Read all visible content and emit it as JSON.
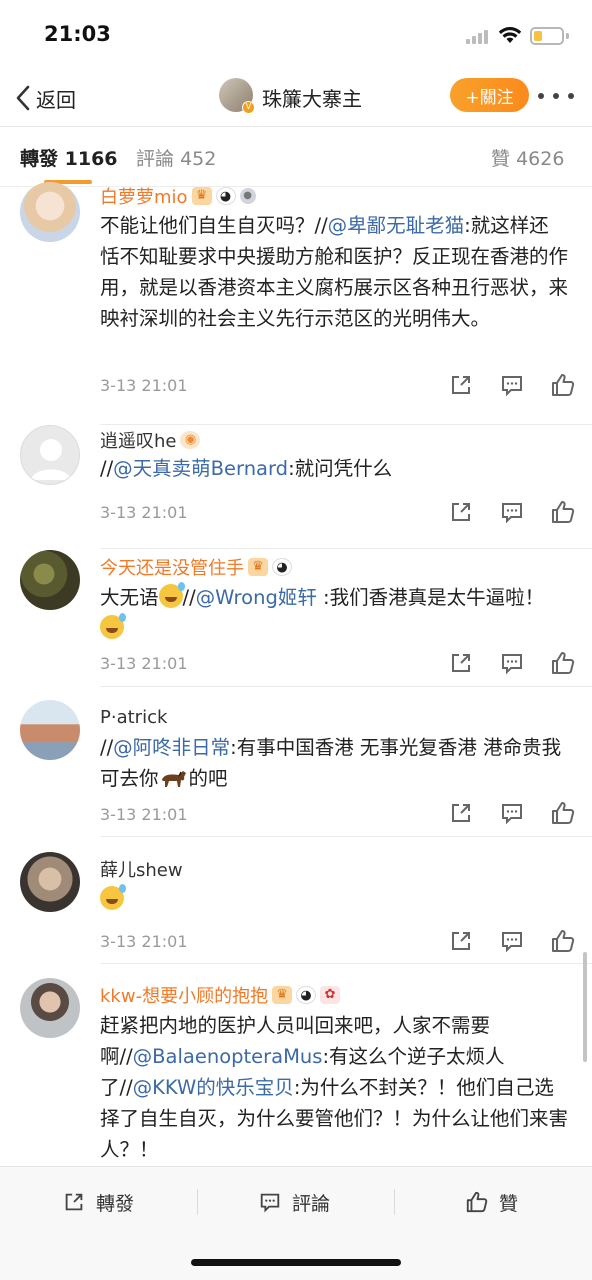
{
  "status_bar": {
    "time": "21:03"
  },
  "nav": {
    "back_label": "返回",
    "title": "珠簾大寨主",
    "follow_label": "+關注"
  },
  "tabs": {
    "repost": {
      "label": "轉發",
      "count": "1166"
    },
    "comments": {
      "label": "評論",
      "count": "452"
    },
    "likes": {
      "label": "贊",
      "count": "4626"
    }
  },
  "comments": [
    {
      "username": "白萝萝mio",
      "text_before": "不能让他们自生自灭吗？//",
      "mention": "@卑鄙无耻老猫",
      "text_after": ":就这样还恬不知耻要求中央援助方舱和医护？反正现在香港的作用，就是以香港资本主义腐朽展示区各种丑行恶状，来映衬深圳的社会主义先行示范区的光明伟大。",
      "time": "3-13 21:01"
    },
    {
      "username": "逍遥叹he",
      "text_before": "//",
      "mention": "@天真卖萌Bernard",
      "text_after": ":就问凭什么",
      "time": "3-13 21:01"
    },
    {
      "username": "今天还是没管住手",
      "text_before": "大无语",
      "text_mid": "//",
      "mention": "@Wrong姬轩",
      "text_after": " :我们香港真是太牛逼啦！",
      "time": "3-13 21:01"
    },
    {
      "username": "P·atrick",
      "text_before": "//",
      "mention": "@阿咚非日常",
      "text_after": ":有事中国香港 无事光复香港 港命贵我可去你",
      "text_end": "的吧",
      "time": "3-13 21:01"
    },
    {
      "username": "薛儿shew",
      "time": "3-13 21:01"
    },
    {
      "username": "kkw-想要小顾的抱抱",
      "text_before": "赶紧把内地的医护人员叫回来吧，人家不需要啊//",
      "mention": "@BalaenopteraMus",
      "text_mid": ":有这么个逆子太烦人了//",
      "mention2": "@KKW的快乐宝贝",
      "text_after": ":为什么不封关？！他们自己选择了自生自灭，为什么要管他们？！为什么让他们来害人？！"
    }
  ],
  "bottom_bar": {
    "repost_label": "轉發",
    "comment_label": "評論",
    "like_label": "贊"
  }
}
